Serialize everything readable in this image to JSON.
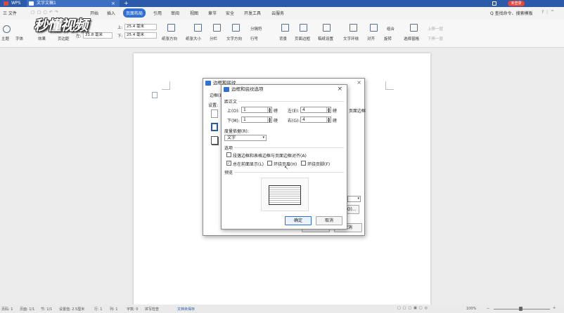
{
  "titlebar": {
    "app_tab": "WPS",
    "doc_tab": "文字文稿1",
    "login_badge": "未登录"
  },
  "menubar": {
    "file": "三 文件",
    "items": [
      "开始",
      "插入",
      "页面布局",
      "引用",
      "审阅",
      "视图",
      "章节",
      "安全",
      "开发工具",
      "云服务"
    ],
    "active_index": 2,
    "search": "Q 查找命令、搜索模板"
  },
  "ribbon": {
    "theme": "主题",
    "font": "字体",
    "effect": "效果",
    "margins": "页边距",
    "top_label": "上:",
    "top_value": "25.4 毫米",
    "bottom_label": "下:",
    "bottom_value": "25.4 毫米",
    "left_label": "左:",
    "left_value": "31.8 毫米",
    "right_label": "右:",
    "right_value": "31.8 毫米",
    "orientation": "纸张方向",
    "size": "纸张大小",
    "columns": "分栏",
    "text_direction": "文字方向",
    "line_num": "行号",
    "section_break": "分隔符",
    "background": "背景",
    "page_border": "页面边框",
    "grid": "稿纸设置",
    "wrap": "文字环绕",
    "align": "对齐",
    "rotate": "旋转",
    "select_pane": "选择窗格",
    "group": "组合",
    "bring_up": "上移一层",
    "send_down": "下移一层"
  },
  "watermark": "秒懂视频",
  "back_dialog": {
    "title": "边框和底纹",
    "tab_border": "边框(B)",
    "setting": "设置:",
    "right_label": "页面边框",
    "ok": "确定",
    "cancel": "取消",
    "options": "选项(O)..."
  },
  "dialog": {
    "title": "边框和底纹选项",
    "close": "×",
    "margins_section": "距正文",
    "top_label": "上(O):",
    "top_value": "1",
    "bottom_label": "下(M):",
    "bottom_value": "1",
    "left_label": "左(E):",
    "left_value": "4",
    "right_label": "右(G):",
    "right_value": "4",
    "unit": "磅",
    "measure_label": "度量依据(R):",
    "measure_value": "文字",
    "options_section": "选项",
    "opt_align": "段落边框和表格边框与页面边框对齐(A)",
    "opt_front": "总在前面显示(L)",
    "opt_header": "环绕页眉(H)",
    "opt_footer": "环绕页脚(F)",
    "opt_align_checked": false,
    "opt_front_checked": true,
    "opt_header_checked": false,
    "opt_footer_checked": false,
    "preview_section": "预览",
    "ok": "确定",
    "cancel": "取消"
  },
  "statusbar": {
    "page": "页码: 1",
    "pages": "页面: 1/1",
    "section": "节: 1/1",
    "setting": "设置值: 2.5厘米",
    "row": "行: 1",
    "col": "列: 1",
    "words": "字数: 0",
    "spell": "拼写检查",
    "doc_status": "文档未保存",
    "zoom": "100%"
  },
  "colors": {
    "accent": "#2b5aa8",
    "active_tab": "#2f6fd6"
  }
}
